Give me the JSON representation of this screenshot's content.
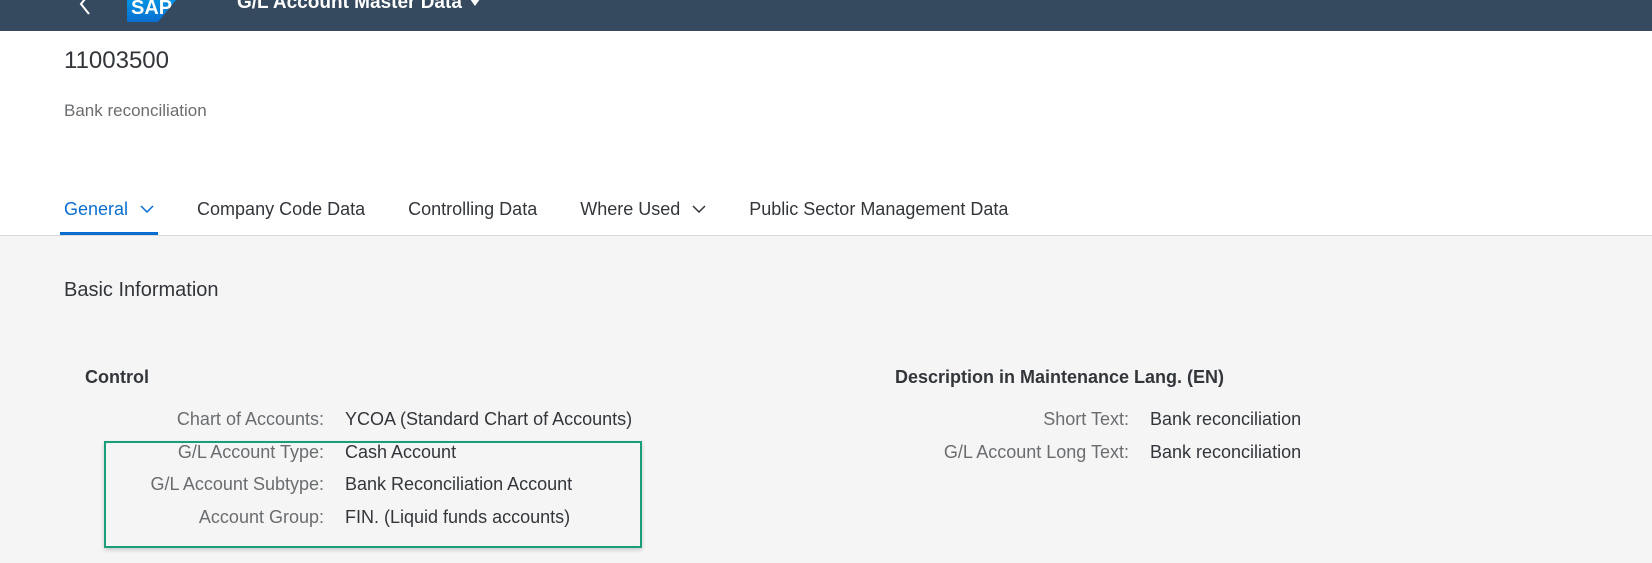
{
  "shell": {
    "app_title": "G/L Account Master Data",
    "logo_text": "SAP"
  },
  "header": {
    "title": "11003500",
    "subtitle": "Bank reconciliation"
  },
  "tabs": [
    {
      "label": "General",
      "has_dropdown": true,
      "active": true
    },
    {
      "label": "Company Code Data",
      "has_dropdown": false,
      "active": false
    },
    {
      "label": "Controlling Data",
      "has_dropdown": false,
      "active": false
    },
    {
      "label": "Where Used",
      "has_dropdown": true,
      "active": false
    },
    {
      "label": "Public Sector Management Data",
      "has_dropdown": false,
      "active": false
    }
  ],
  "section": {
    "title": "Basic Information"
  },
  "control": {
    "title": "Control",
    "rows": [
      {
        "label": "Chart of Accounts:",
        "value": "YCOA (Standard Chart of Accounts)"
      },
      {
        "label": "G/L Account Type:",
        "value": "Cash Account"
      },
      {
        "label": "G/L Account Subtype:",
        "value": "Bank Reconciliation Account"
      },
      {
        "label": "Account Group:",
        "value": "FIN. (Liquid funds accounts)"
      }
    ]
  },
  "description": {
    "title": "Description in Maintenance Lang. (EN)",
    "rows": [
      {
        "label": "Short Text:",
        "value": "Bank reconciliation"
      },
      {
        "label": "G/L Account Long Text:",
        "value": "Bank reconciliation"
      }
    ]
  },
  "colors": {
    "shell_bg": "#354a5f",
    "accent": "#0a6ed1",
    "highlight_border": "#1a9e7a",
    "sap_logo_blue": "#0a6ed1"
  },
  "icons": {
    "back": "back-chevron-icon",
    "title_caret": "caret-down-icon",
    "tab_chevron": "chevron-down-icon"
  }
}
